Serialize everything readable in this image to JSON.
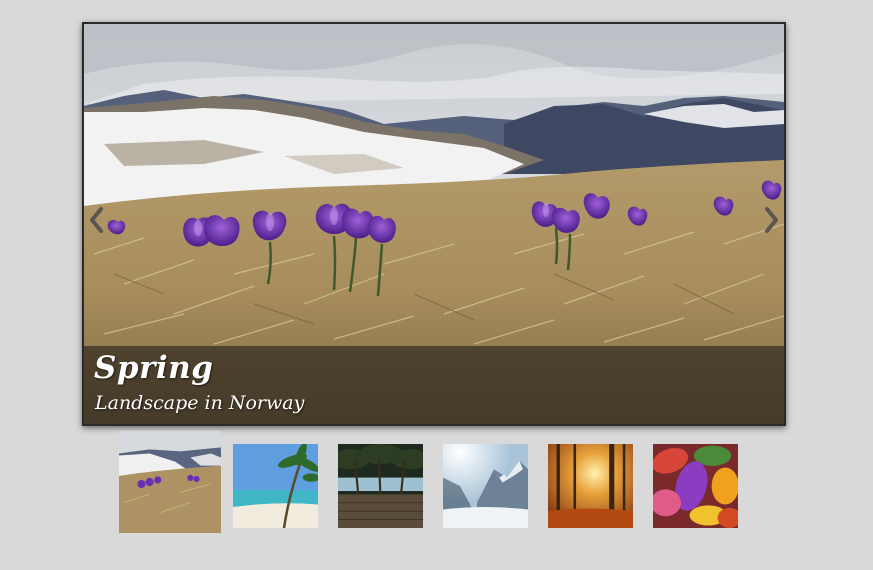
{
  "slider": {
    "caption_title": "Spring",
    "caption_subtitle": "Landscape in Norway",
    "prev_icon": "chevron-left-icon",
    "next_icon": "chevron-right-icon",
    "active_index": 0
  },
  "thumbnails": [
    {
      "subject": "spring crocus meadow with snowy mountains"
    },
    {
      "subject": "palm tree beach"
    },
    {
      "subject": "palm grove with boardwalk"
    },
    {
      "subject": "snowy winter forest"
    },
    {
      "subject": "autumn forest with sunlight"
    },
    {
      "subject": "colorful autumn leaves"
    }
  ],
  "colors": {
    "page_background": "#d9d9d9",
    "caption_background": "#231e19",
    "caption_text": "#ffffff"
  }
}
